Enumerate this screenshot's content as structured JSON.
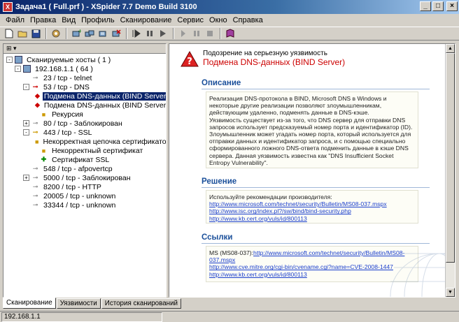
{
  "window": {
    "title": "Задача1 ( Full.prf ) - XSpider 7.7 Demo Build 3100",
    "controls": [
      "_",
      "□",
      "×"
    ]
  },
  "menu": [
    "Файл",
    "Правка",
    "Вид",
    "Профиль",
    "Сканирование",
    "Сервис",
    "Окно",
    "Справка"
  ],
  "toolbar": {
    "buttons": [
      "new-icon",
      "open-icon",
      "save-icon",
      "scan-profile-icon",
      "add-host-icon",
      "add-range-icon",
      "add-list-icon",
      "remove-host-icon",
      "start-scan-icon",
      "pause-icon",
      "play-icon",
      "resume-icon",
      "stop-icon",
      "help-book-icon"
    ]
  },
  "tree": {
    "header_label": "",
    "rows": [
      {
        "label": "Сканируемые хосты ( 1 )",
        "indent": 0,
        "icon": "hosts",
        "twist": "-"
      },
      {
        "label": "192.168.1.1 ( 64 )",
        "indent": 1,
        "icon": "computer",
        "twist": "-"
      },
      {
        "label": "23 / tcp - telnet",
        "indent": 2,
        "icon": "port"
      },
      {
        "label": "53 / tcp - DNS",
        "indent": 2,
        "icon": "warnred-port",
        "twist": "-"
      },
      {
        "label": "Подмена DNS-данных (BIND Server)",
        "indent": 3,
        "icon": "warnred",
        "selected": true
      },
      {
        "label": "Подмена DNS-данных (BIND Server)",
        "indent": 3,
        "icon": "warnred"
      },
      {
        "label": "Рекурсия",
        "indent": 3,
        "icon": "warnyel"
      },
      {
        "label": "80 / tcp - Заблокирован",
        "indent": 2,
        "icon": "port",
        "twist": "+"
      },
      {
        "label": "443 / tcp - SSL",
        "indent": 2,
        "icon": "warnyel-port",
        "twist": "-"
      },
      {
        "label": "Некорректная цепочка сертификатов",
        "indent": 3,
        "icon": "warnyel"
      },
      {
        "label": "Некорректный сертификат",
        "indent": 3,
        "icon": "warnyel"
      },
      {
        "label": "Сертификат SSL",
        "indent": 3,
        "icon": "info"
      },
      {
        "label": "548 / tcp - afpovertcp",
        "indent": 2,
        "icon": "port"
      },
      {
        "label": "5000 / tcp - Заблокирован",
        "indent": 2,
        "icon": "port",
        "twist": "+"
      },
      {
        "label": "8200 / tcp - HTTP",
        "indent": 2,
        "icon": "port"
      },
      {
        "label": "20005 / tcp - unknown",
        "indent": 2,
        "icon": "port"
      },
      {
        "label": "33344 / tcp - unknown",
        "indent": 2,
        "icon": "port"
      }
    ]
  },
  "details": {
    "severity_label": "Подозрение на серьезную уязвимость",
    "vuln_title": "Подмена DNS-данных (BIND Server)",
    "description_title": "Описание",
    "description_text": "Реализация DNS-протокола в BIND, Microsoft DNS в Windows и некоторые другие реализации позволяют злоумышленникам, действующим удаленно, подменять данные в DNS-кэше.\nУязвимость существует из-за того, что DNS сервер для отправки DNS запросов использует предсказуемый номер порта и идентификатор (ID). Злоумышленник может угадать номер порта, который используется для отправки данных и идентификатор запроса, и с помощью специально сформированного ложного DNS-ответа подменить данные в кэше DNS сервера. Данная уязвимость известна как \"DNS Insufficient Socket Entropy Vulnerability\".",
    "solution_title": "Решение",
    "solution_intro": "Используйте рекомендации производителя:",
    "solution_links": [
      "http://www.microsoft.com/technet/security/Bulletin/MS08-037.mspx",
      "http://www.isc.org/index.pl?/sw/bind/bind-security.php",
      "http://www.kb.cert.org/vuls/id/800113"
    ],
    "links_title": "Ссылки",
    "ms_prefix": "MS (MS08-037):",
    "ms_link": "http://www.microsoft.com/technet/security/Bulletin/MS08-037.mspx",
    "ref_links": [
      "http://www.cve.mitre.org/cgi-bin/cvename.cgi?name=CVE-2008-1447",
      "http://www.kb.cert.org/vuls/id/800113"
    ]
  },
  "tabs": [
    "Сканирование",
    "Уязвимости",
    "История сканирований"
  ],
  "status": {
    "host": "192.168.1.1"
  }
}
